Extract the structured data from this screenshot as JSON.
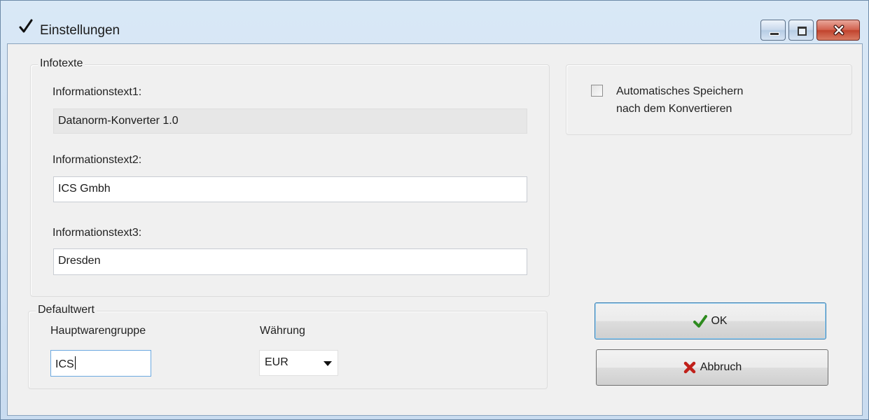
{
  "window": {
    "title": "Einstellungen"
  },
  "infotexte": {
    "legend": "Infotexte",
    "label1": "Informationstext1:",
    "value1": "Datanorm-Konverter 1.0",
    "label2": "Informationstext2:",
    "value2": "ICS Gmbh",
    "label3": "Informationstext3:",
    "value3": "Dresden"
  },
  "options": {
    "autosave_label_line1": "Automatisches Speichern",
    "autosave_label_line2": "nach dem Konvertieren",
    "autosave_checked": false
  },
  "defaultwert": {
    "legend": "Defaultwert",
    "hauptwarengruppe_label": "Hauptwarengruppe",
    "hauptwarengruppe_value": "ICS",
    "waehrung_label": "Währung",
    "waehrung_value": "EUR"
  },
  "buttons": {
    "ok_label": "OK",
    "cancel_label": "Abbruch"
  },
  "colors": {
    "ok_icon": "#2e8b1f",
    "cancel_icon": "#c0201a",
    "close_button": "#c1432d"
  },
  "icons": {
    "title": "checkmark-icon",
    "minimize": "minimize-icon",
    "maximize": "maximize-icon",
    "close": "close-icon",
    "ok": "checkmark-icon",
    "cancel": "x-icon",
    "combo": "chevron-down-icon"
  }
}
